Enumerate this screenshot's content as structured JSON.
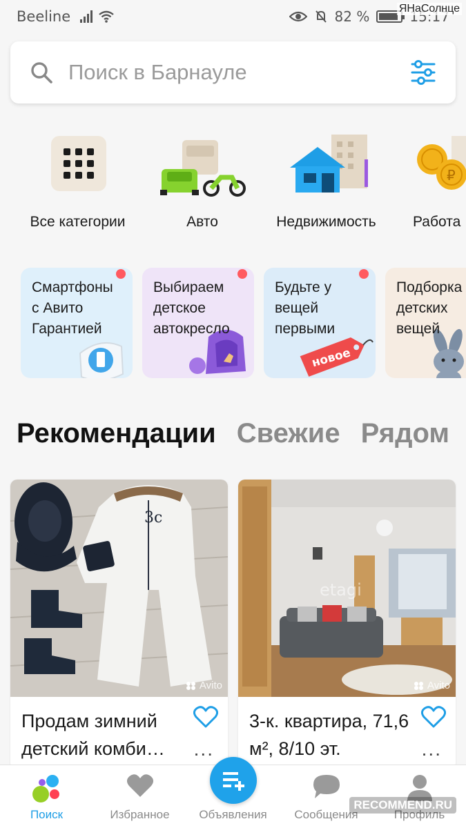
{
  "status_bar": {
    "carrier": "Beeline",
    "battery": "82 %",
    "time": "15:17"
  },
  "watermarks": {
    "top": "ЯНаСолнце",
    "bottom": "RECOMMEND.RU",
    "photo": "Avito",
    "photo2": "etagi"
  },
  "search": {
    "placeholder": "Поиск в Барнауле",
    "icon": "search-icon",
    "filter_icon": "filter-sliders-icon",
    "accent": "#1e9ee6"
  },
  "categories": [
    {
      "label": "Все категории",
      "icon": "grid-icon"
    },
    {
      "label": "Авто",
      "icon": "car-motorcycle-icon"
    },
    {
      "label": "Недвижимость",
      "icon": "house-icon"
    },
    {
      "label": "Работа",
      "icon": "coins-icon"
    }
  ],
  "stories": [
    {
      "text": "Смартфоны с Авито Гарантией",
      "bg": "#dff0fb"
    },
    {
      "text": "Выбираем детское автокресло",
      "bg": "#efe4f8"
    },
    {
      "text": "Будьте у вещей первыми",
      "bg": "#dcecf9",
      "tag": "новое"
    },
    {
      "text": "Подборка детских вещей",
      "bg": "#f6ece2"
    }
  ],
  "feed_tabs": [
    {
      "label": "Рекомендации",
      "active": true
    },
    {
      "label": "Свежие",
      "active": false
    },
    {
      "label": "Рядом",
      "active": false
    }
  ],
  "listings": [
    {
      "title": "Продам зимний детский комби…",
      "more": "..."
    },
    {
      "title": "3-к. квартира, 71,6 м², 8/10 эт.",
      "more": "..."
    }
  ],
  "bottom_nav": [
    {
      "label": "Поиск",
      "icon": "avito-dots-icon",
      "active": true
    },
    {
      "label": "Избранное",
      "icon": "heart-icon",
      "active": false
    },
    {
      "label": "Объявления",
      "icon": "add-listing-icon",
      "active": false
    },
    {
      "label": "Сообщения",
      "icon": "chat-bubble-icon",
      "active": false
    },
    {
      "label": "Профиль",
      "icon": "user-icon",
      "active": false
    }
  ]
}
